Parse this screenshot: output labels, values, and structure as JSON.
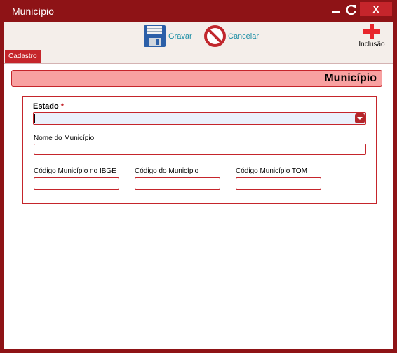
{
  "window": {
    "title": "Município",
    "close_label": "X"
  },
  "toolbar": {
    "save_label": "Gravar",
    "cancel_label": "Cancelar",
    "insert_label": "Inclusão"
  },
  "tabs": [
    {
      "label": "Cadastro",
      "active": true
    }
  ],
  "section": {
    "title": "Município"
  },
  "form": {
    "estado_label": "Estado",
    "required_mark": "*",
    "estado_value": "",
    "nome_label": "Nome do Município",
    "nome_value": "",
    "ibge_label": "Código Município no IBGE",
    "ibge_value": "",
    "codigo_label": "Código do Município",
    "codigo_value": "",
    "tom_label": "Código Município TOM",
    "tom_value": ""
  },
  "colors": {
    "primary": "#8e1316",
    "accent": "#c5252b",
    "header_fill": "#f8a1a1",
    "link": "#1c8ea5"
  },
  "icons": {
    "save": "floppy-disk-icon",
    "cancel": "no-entry-icon",
    "insert": "plus-icon",
    "refresh": "refresh-icon",
    "minimize": "minimize-icon"
  }
}
